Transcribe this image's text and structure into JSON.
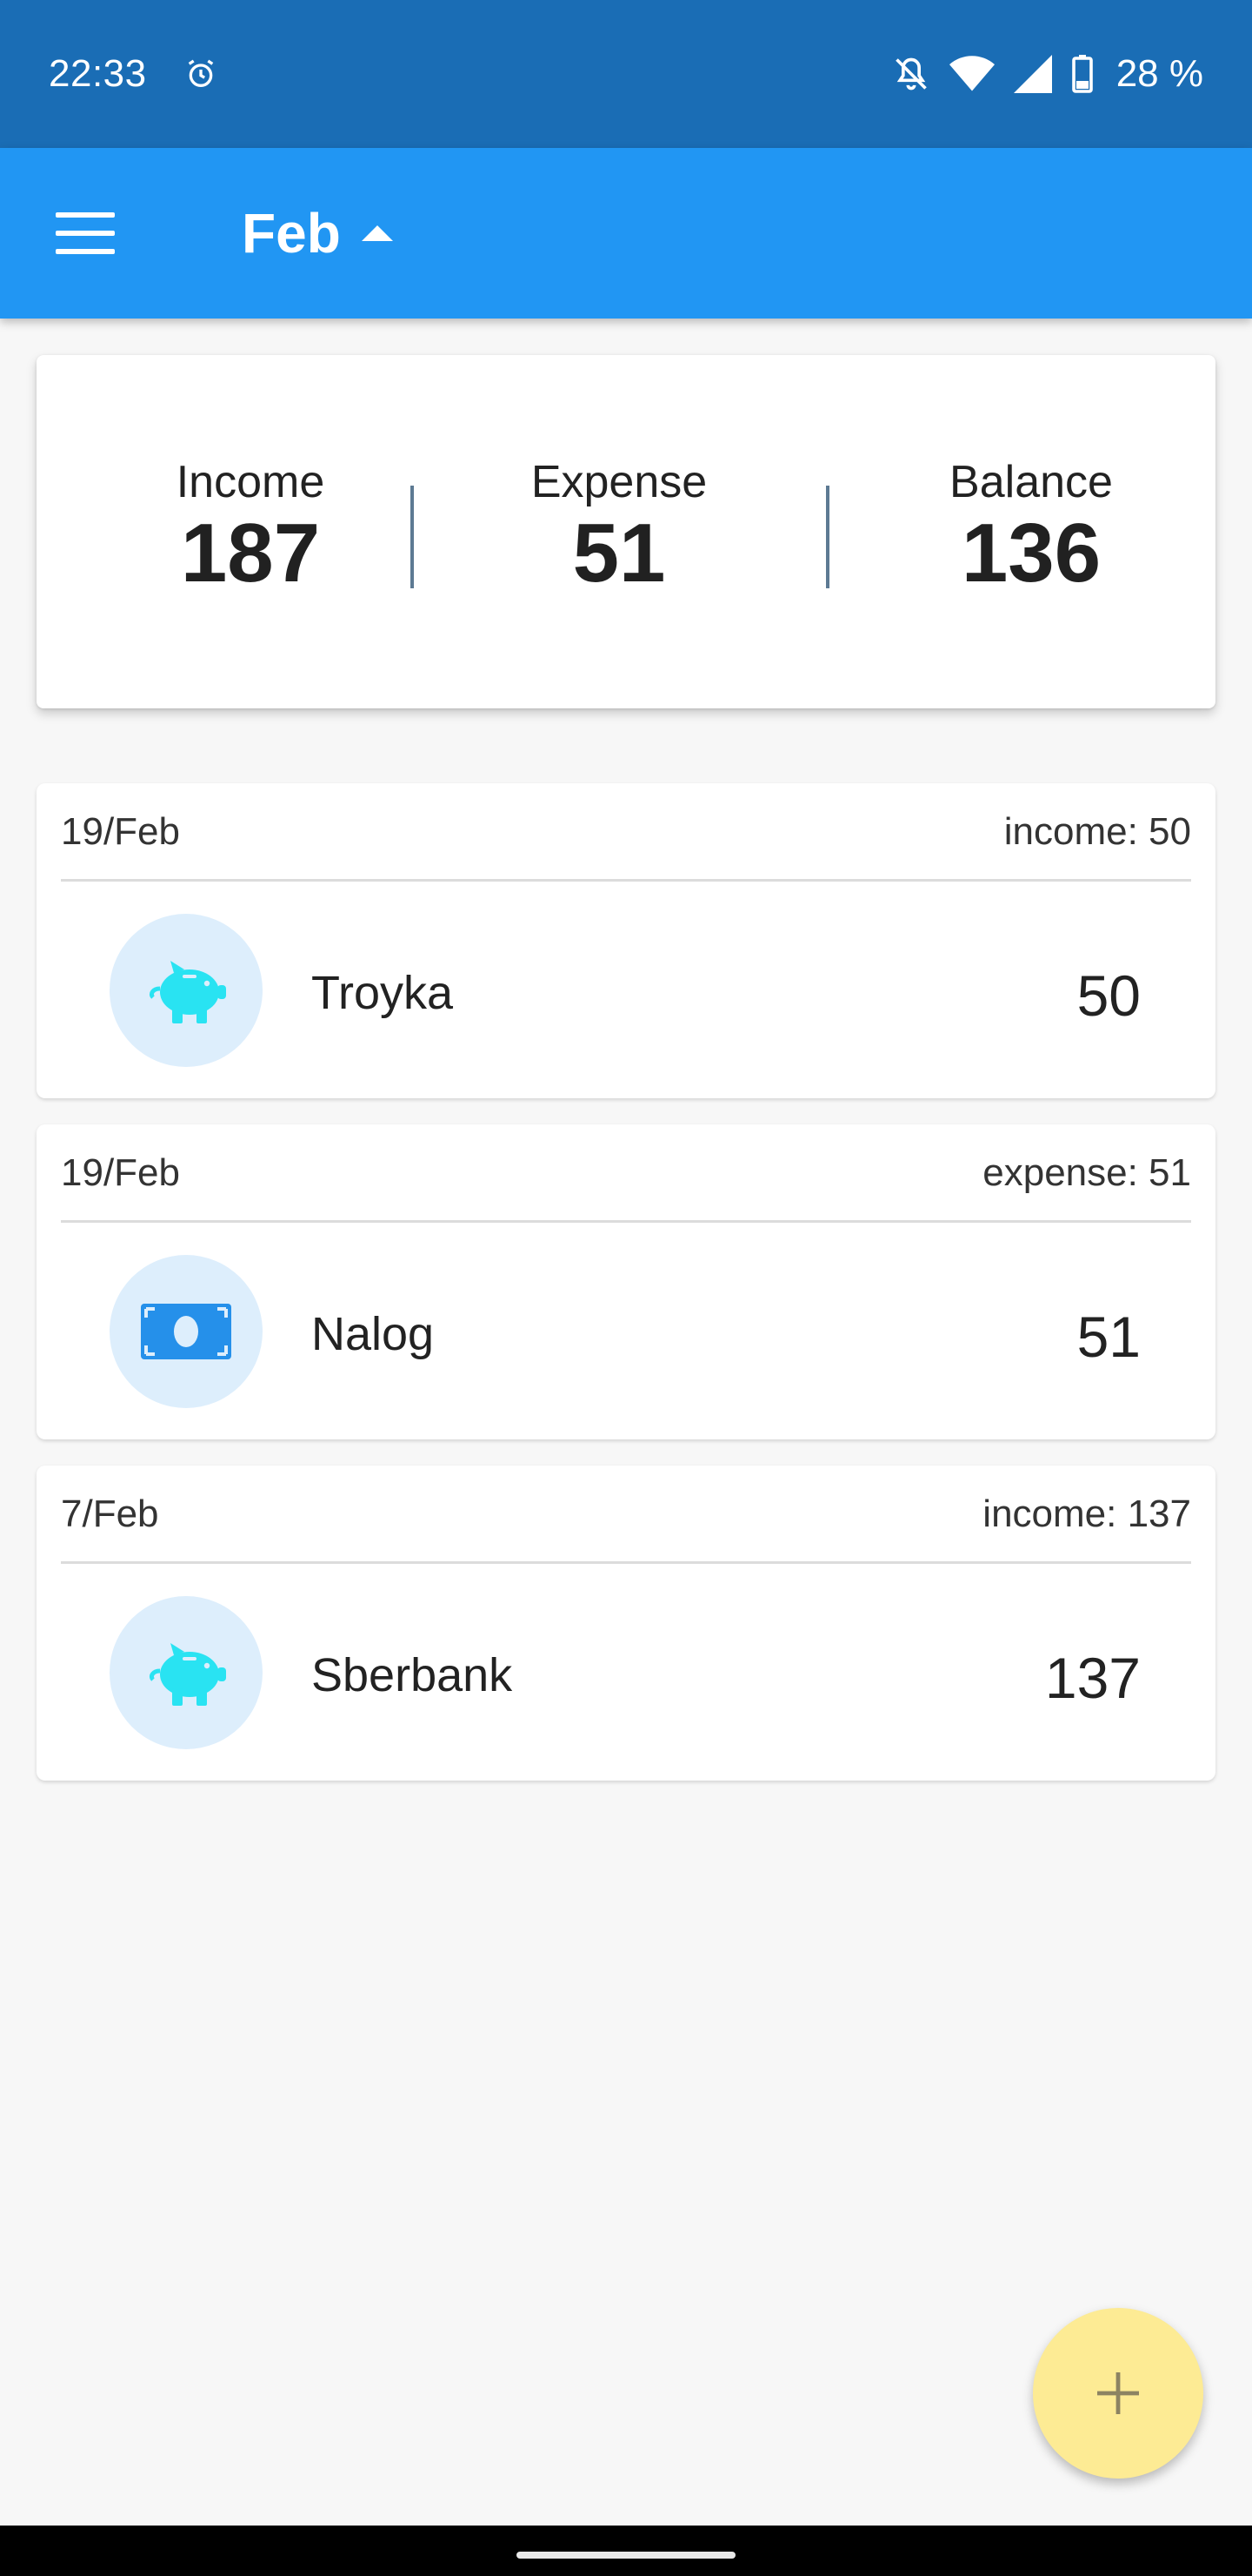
{
  "status_bar": {
    "time": "22:33",
    "battery": "28 %",
    "icons": [
      "alarm-icon",
      "bell-off-icon",
      "wifi-icon",
      "cell-signal-icon",
      "battery-icon"
    ]
  },
  "app_bar": {
    "month": "Feb",
    "menu_icon": "menu-icon",
    "caret_icon": "caret-up-icon",
    "background": "#2196f3"
  },
  "summary": {
    "income_label": "Income",
    "income_value": "187",
    "expense_label": "Expense",
    "expense_value": "51",
    "balance_label": "Balance",
    "balance_value": "136"
  },
  "transactions": [
    {
      "date": "19/Feb",
      "subtotal": "income: 50",
      "name": "Troyka",
      "amount": "50",
      "icon": "piggy-bank-icon",
      "icon_color": "#29e3f2"
    },
    {
      "date": "19/Feb",
      "subtotal": "expense: 51",
      "name": "Nalog",
      "amount": "51",
      "icon": "banknote-icon",
      "icon_color": "#2590ea"
    },
    {
      "date": "7/Feb",
      "subtotal": "income: 137",
      "name": "Sberbank",
      "amount": "137",
      "icon": "piggy-bank-icon",
      "icon_color": "#29e3f2"
    }
  ],
  "fab": {
    "icon": "plus-icon",
    "color": "#fdeb94"
  }
}
